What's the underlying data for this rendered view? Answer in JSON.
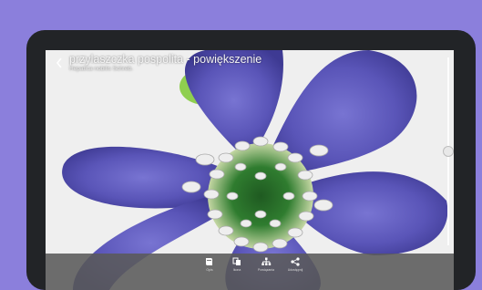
{
  "header": {
    "title": "przylaszczka pospolita - powiększenie",
    "subtitle": "Hepatica nobilis Schreb."
  },
  "zoom": {
    "level": 0.5
  },
  "toolbar": {
    "items": [
      {
        "label": "Opis",
        "icon": "book-icon"
      },
      {
        "label": "Ikona",
        "icon": "cards-icon"
      },
      {
        "label": "Powiązania",
        "icon": "hierarchy-icon"
      },
      {
        "label": "Udostępnij",
        "icon": "share-icon"
      }
    ]
  },
  "colors": {
    "background": "#8b7fdc",
    "device": "#222427",
    "petal": "#5a55b8",
    "toolbar": "#5a5a5a"
  }
}
